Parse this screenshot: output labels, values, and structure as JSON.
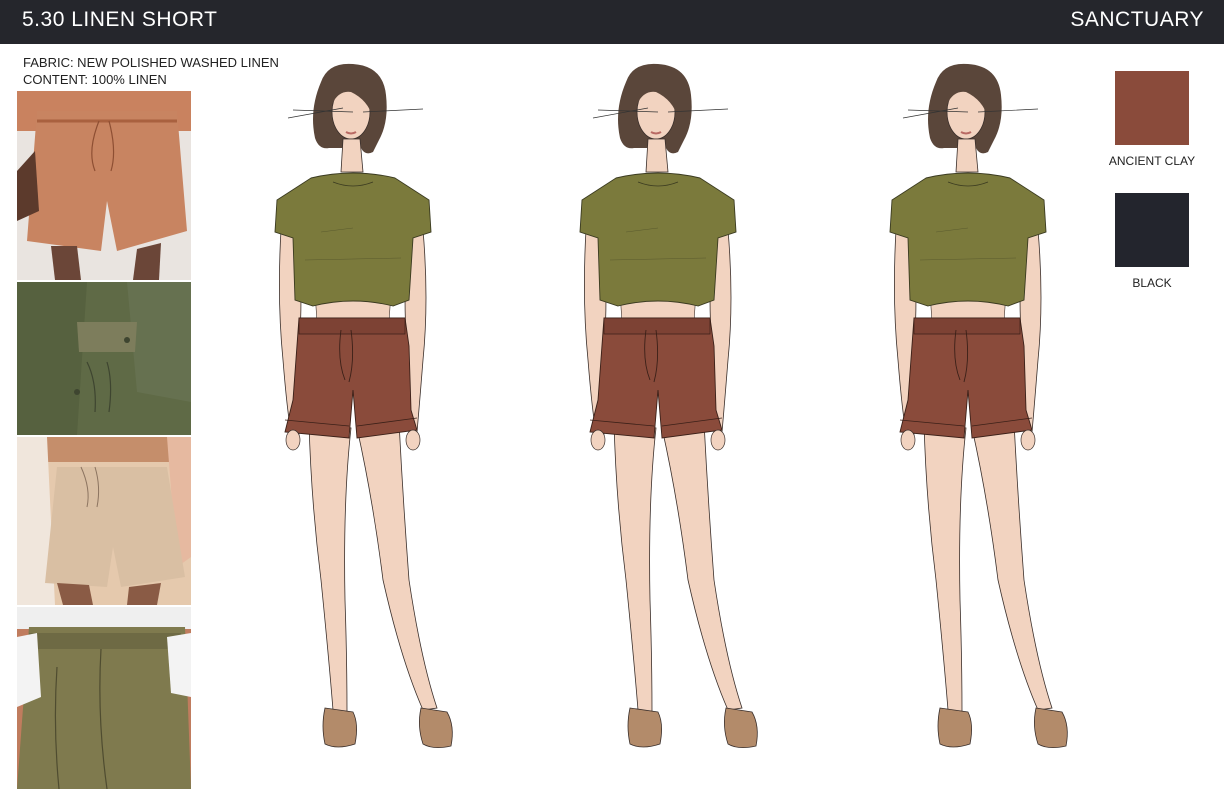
{
  "header": {
    "title": "5.30 LINEN SHORT",
    "brand": "SANCTUARY",
    "background": "#25262c"
  },
  "specs": {
    "fabric": "FABRIC: NEW POLISHED WASHED LINEN",
    "content": "CONTENT: 100% LINEN"
  },
  "inspiration_photos": [
    {
      "icon": "photo-clay-linen-shorts",
      "color": "#c88461"
    },
    {
      "icon": "photo-olive-shirt-and-shorts",
      "color": "#5f6a46"
    },
    {
      "icon": "photo-beige-linen-shorts",
      "color": "#d9bfa3"
    },
    {
      "icon": "photo-khaki-paperbag-pants",
      "color": "#7f7a4e"
    }
  ],
  "sketches": [
    {
      "icon": "fashion-sketch-front",
      "top_color": "#7b7a3c",
      "shorts_color": "#8a4b3b"
    },
    {
      "icon": "fashion-sketch-front",
      "top_color": "#7b7a3c",
      "shorts_color": "#8a4b3b"
    },
    {
      "icon": "fashion-sketch-front",
      "top_color": "#7b7a3c",
      "shorts_color": "#8a4b3b"
    }
  ],
  "colorways": [
    {
      "name": "ANCIENT CLAY",
      "color": "#8a4b3b"
    },
    {
      "name": "BLACK",
      "color": "#23252d"
    }
  ]
}
